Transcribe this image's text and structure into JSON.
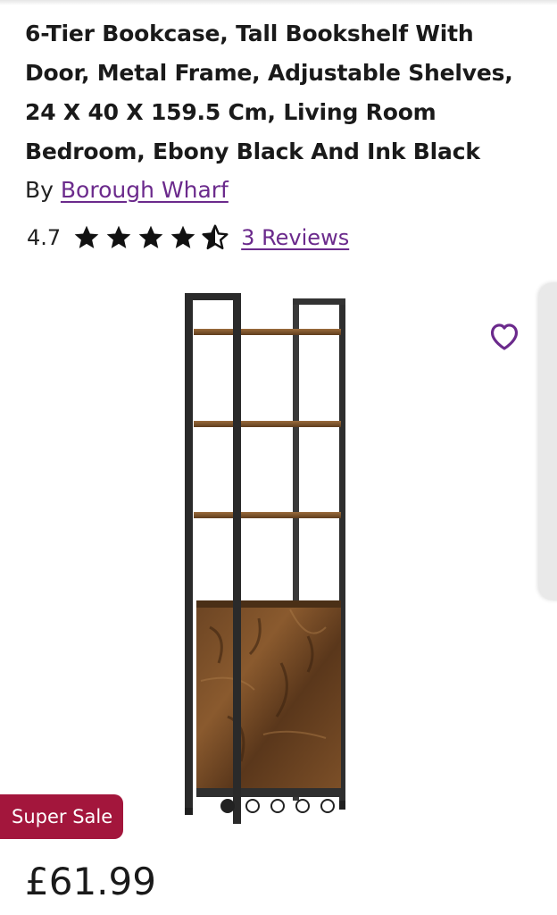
{
  "product": {
    "title": "6-Tier Bookcase, Tall Bookshelf With Door, Metal Frame, Adjustable Shelves, 24 X 40 X 159.5 Cm, Living Room Bedroom, Ebony Black And Ink Black",
    "brand_prefix": "By",
    "brand_name": "Borough Wharf",
    "rating_value": "4.7",
    "rating_stars": 4.7,
    "reviews_label": "3 Reviews",
    "sale_badge": "Super Sale",
    "price": "£61.99"
  },
  "gallery": {
    "image_subject": "bookshelf-product-image",
    "image_count": 5,
    "active_index": 0
  },
  "icons": {
    "wishlist": "heart-icon",
    "star": "star-icon"
  },
  "colors": {
    "accent_purple": "#6b2a8c",
    "sale_red": "#a3163c",
    "text_dark": "#1a1a1a"
  }
}
